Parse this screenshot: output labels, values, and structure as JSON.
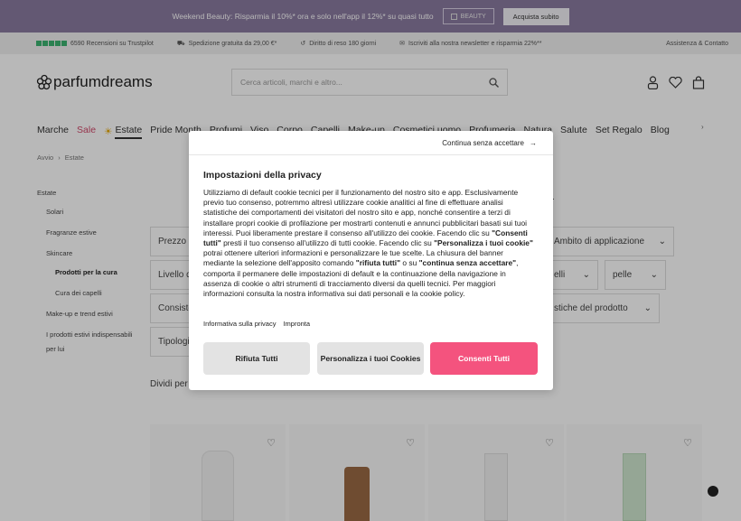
{
  "promo": {
    "text": "Weekend Beauty: Risparmia il 10%* ora e solo nell'app il 12%* su quasi tutto",
    "code": "BEAUTY",
    "cta": "Acquista subito"
  },
  "infobar": {
    "reviews": "6590 Recensioni su Trustpilot",
    "shipping": "Spedizione gratuita da 29,00 €*",
    "returns": "Diritto di reso 180 giorni",
    "newsletter": "Iscriviti alla nostra newsletter e risparmia 22%**",
    "help": "Assistenza & Contatto"
  },
  "header": {
    "logo": "parfumdreams",
    "search_placeholder": "Cerca articoli, marchi e altro..."
  },
  "nav": [
    "Marche",
    "Sale",
    "Estate",
    "Pride Month",
    "Profumi",
    "Viso",
    "Corpo",
    "Capelli",
    "Make-up",
    "Cosmetici uomo",
    "Profumeria",
    "Natura",
    "Salute",
    "Set Regalo",
    "Blog"
  ],
  "breadcrumb": {
    "home": "Avvio",
    "current": "Estate"
  },
  "sidebar": {
    "title": "Estate",
    "items": [
      "Solari",
      "Fragranze estive",
      "Skincare",
      "Prodotti per la cura",
      "Cura dei capelli",
      "Make-up e trend estivi",
      "I prodotti estivi indispensabili",
      "per lui"
    ]
  },
  "filters": {
    "prezzo": "Prezzo",
    "ambito": "Ambito di applicazione",
    "livello": "Livello d",
    "elli": "elli",
    "pelle": "pelle",
    "consistenza": "Consiste",
    "caratteristiche": "stiche del prodotto",
    "tipologia": "Tipologi"
  },
  "heading_fragment": "a",
  "sort_text": "Dividi per",
  "cookie": {
    "continue_label": "Continua senza accettare",
    "title": "Impostazioni della privacy",
    "body": [
      "Utilizziamo di default cookie tecnici per il funzionamento del nostro sito e app. Esclusivamente previo tuo consenso, potremmo altresì utilizzare cookie analitici al fine di effettuare analisi statistiche dei comportamenti dei visitatori del nostro sito e app, nonché consentire a terzi di installare propri cookie di profilazione per mostrarti contenuti e annunci pubblicitari basati sui tuoi interessi. Puoi liberamente prestare il consenso all'utilizzo dei cookie. Facendo clic su ",
      "\"Consenti tutti\"",
      " presti il tuo consenso all'utilizzo di tutti cookie. Facendo clic su ",
      "\"Personalizza i tuoi cookie\"",
      " potrai ottenere ulteriori informazioni e personalizzare le tue scelte. La chiusura del banner mediante la selezione dell'apposito comando ",
      "\"rifiuta tutti\"",
      " o su ",
      "\"continua senza accettare\"",
      ", comporta il permanere delle impostazioni di default e la continuazione della navigazione in assenza di cookie o altri strumenti di tracciamento diversi da quelli tecnici. Per maggiori informazioni consulta la nostra informativa sui dati personali e la cookie policy."
    ],
    "link_privacy": "Informativa sulla privacy",
    "link_imprint": "Impronta",
    "btn_reject": "Rifiuta Tutti",
    "btn_customize": "Personalizza i tuoi Cookies",
    "btn_accept": "Consenti Tutti"
  },
  "colors": {
    "promo_bg": "#8a7aa0",
    "accept": "#f4537e",
    "sale": "#d0486a"
  }
}
